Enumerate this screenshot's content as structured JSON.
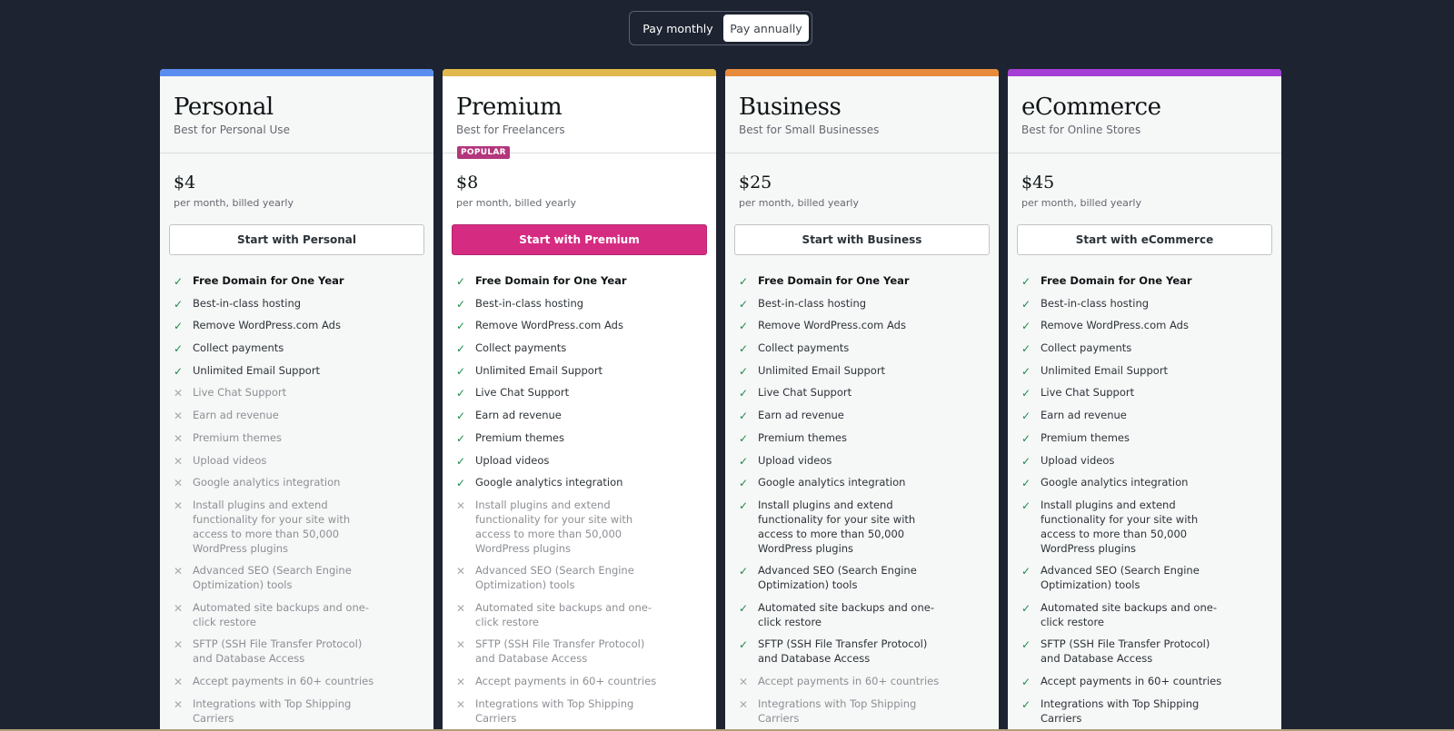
{
  "toggle": {
    "monthly": "Pay monthly",
    "annually": "Pay annually",
    "selected": "annually"
  },
  "colors": {
    "personal": "#5b8def",
    "premium": "#e0b84b",
    "business": "#e68a3b",
    "ecommerce": "#a43ed4",
    "cta_primary": "#d52c82",
    "badge": "#b3367c"
  },
  "plans": [
    {
      "name": "Personal",
      "tagline": "Best for Personal Use",
      "price": "$4",
      "price_note": "per month, billed yearly",
      "cta": "Start with Personal"
    },
    {
      "name": "Premium",
      "tagline": "Best for Freelancers",
      "badge": "POPULAR",
      "price": "$8",
      "price_note": "per month, billed yearly",
      "cta": "Start with Premium"
    },
    {
      "name": "Business",
      "tagline": "Best for Small Businesses",
      "price": "$25",
      "price_note": "per month, billed yearly",
      "cta": "Start with Business"
    },
    {
      "name": "eCommerce",
      "tagline": "Best for Online Stores",
      "price": "$45",
      "price_note": "per month, billed yearly",
      "cta": "Start with eCommerce"
    }
  ],
  "features": [
    "Free Domain for One Year",
    "Best-in-class hosting",
    "Remove WordPress.com Ads",
    "Collect payments",
    "Unlimited Email Support",
    "Live Chat Support",
    "Earn ad revenue",
    "Premium themes",
    "Upload videos",
    "Google analytics integration",
    "Install plugins and extend functionality for your site with access to more than 50,000 WordPress plugins",
    "Advanced SEO (Search Engine Optimization) tools",
    "Automated site backups and one-click restore",
    "SFTP (SSH File Transfer Protocol) and Database Access",
    "Accept payments in 60+ countries",
    "Integrations with Top Shipping Carriers"
  ],
  "availability": {
    "personal": [
      true,
      true,
      true,
      true,
      true,
      false,
      false,
      false,
      false,
      false,
      false,
      false,
      false,
      false,
      false,
      false
    ],
    "premium": [
      true,
      true,
      true,
      true,
      true,
      true,
      true,
      true,
      true,
      true,
      false,
      false,
      false,
      false,
      false,
      false
    ],
    "business": [
      true,
      true,
      true,
      true,
      true,
      true,
      true,
      true,
      true,
      true,
      true,
      true,
      true,
      true,
      false,
      false
    ],
    "ecommerce": [
      true,
      true,
      true,
      true,
      true,
      true,
      true,
      true,
      true,
      true,
      true,
      true,
      true,
      true,
      true,
      true
    ]
  }
}
